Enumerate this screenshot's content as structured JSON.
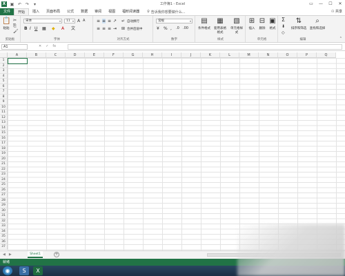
{
  "titlebar": {
    "title": "工作簿1 - Excel",
    "logo": "X",
    "save_icon": "save-icon",
    "undo_icon": "undo-icon",
    "redo_icon": "redo-icon",
    "customize_icon": "customize-icon"
  },
  "window_controls": {
    "ribbon_options": "▭",
    "minimize": "—",
    "maximize": "☐",
    "close": "✕"
  },
  "tabs": [
    {
      "label": "文件"
    },
    {
      "label": "开始"
    },
    {
      "label": "插入"
    },
    {
      "label": "页面布局"
    },
    {
      "label": "公式"
    },
    {
      "label": "数据"
    },
    {
      "label": "审阅"
    },
    {
      "label": "视图"
    },
    {
      "label": "福昕阅读器"
    }
  ],
  "tell_me": {
    "placeholder": "告诉我你想要做什么..."
  },
  "share": {
    "label": "共享"
  },
  "ribbon": {
    "clipboard": {
      "label": "剪贴板",
      "paste": "粘贴"
    },
    "font": {
      "label": "字体",
      "font_name": "宋体",
      "font_size": "11"
    },
    "alignment": {
      "label": "对齐方式",
      "wrap_text": "自动换行",
      "merge_center": "合并后居中"
    },
    "number": {
      "label": "数字",
      "format": "常规"
    },
    "styles": {
      "label": "样式",
      "conditional": "条件格式",
      "as_table": "套用表格格式",
      "cell_styles": "单元格样式"
    },
    "cells": {
      "label": "单元格",
      "insert": "插入",
      "delete": "删除",
      "format": "格式"
    },
    "editing": {
      "label": "编辑",
      "sort_filter": "排序和筛选",
      "find_select": "查找和选择"
    }
  },
  "formula_bar": {
    "name_box": "A1",
    "fx": "fx"
  },
  "columns": [
    "A",
    "B",
    "C",
    "D",
    "E",
    "F",
    "G",
    "H",
    "I",
    "J",
    "K",
    "L",
    "M",
    "N",
    "O",
    "P",
    "Q"
  ],
  "rows": [
    "1",
    "2",
    "3",
    "4",
    "5",
    "6",
    "7",
    "8",
    "9",
    "10",
    "11",
    "12",
    "13",
    "14",
    "15",
    "16",
    "17",
    "18",
    "19",
    "20",
    "21",
    "22",
    "23",
    "24",
    "25",
    "26",
    "27",
    "28",
    "29",
    "30",
    "31",
    "32",
    "33",
    "34",
    "35",
    "36",
    "37"
  ],
  "sheets": [
    {
      "label": "Sheet1"
    }
  ],
  "status": {
    "text": "就绪"
  },
  "colors": {
    "accent": "#217346"
  }
}
